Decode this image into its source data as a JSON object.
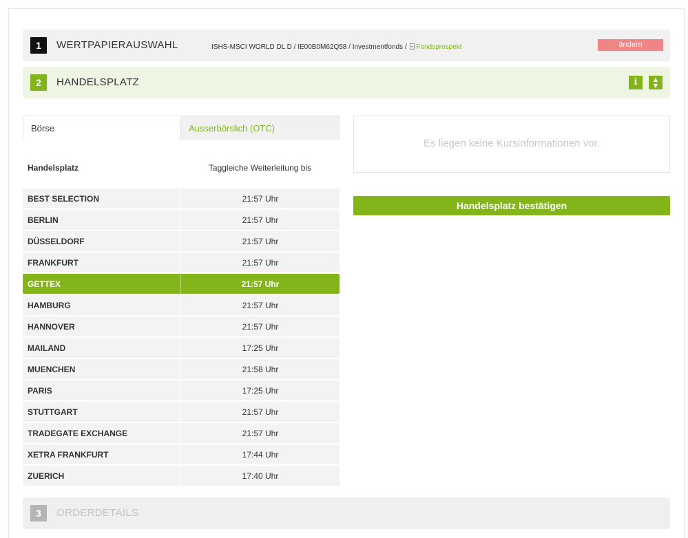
{
  "step1": {
    "number": "1",
    "title": "WERTPAPIERAUSWAHL",
    "security_info": "ISHS-MSCI WORLD DL D / IE00B0M62Q58 / Investmentfonds /",
    "prospekt_label": "Fondsprospekt",
    "change_label": "ändern",
    "change_color": "#f08585"
  },
  "step2": {
    "number": "2",
    "title": "HANDELSPLATZ",
    "info_icon": "i",
    "toggle_icon_up": "▲",
    "toggle_icon_down": "▼",
    "accent_color": "#83b51a"
  },
  "tabs": {
    "exchange": "Börse",
    "otc": "Ausserbörslich (OTC)",
    "active": "exchange"
  },
  "table": {
    "col_venue": "Handelsplatz",
    "col_time": "Taggleiche Weiterleitung bis",
    "rows": [
      {
        "venue": "BEST SELECTION",
        "time": "21:57 Uhr"
      },
      {
        "venue": "BERLIN",
        "time": "21:57 Uhr"
      },
      {
        "venue": "DÜSSELDORF",
        "time": "21:57 Uhr"
      },
      {
        "venue": "FRANKFURT",
        "time": "21:57 Uhr"
      },
      {
        "venue": "GETTEX",
        "time": "21:57 Uhr"
      },
      {
        "venue": "HAMBURG",
        "time": "21:57 Uhr"
      },
      {
        "venue": "HANNOVER",
        "time": "21:57 Uhr"
      },
      {
        "venue": "MAILAND",
        "time": "17:25 Uhr"
      },
      {
        "venue": "MUENCHEN",
        "time": "21:58 Uhr"
      },
      {
        "venue": "PARIS",
        "time": "17:25 Uhr"
      },
      {
        "venue": "STUTTGART",
        "time": "21:57 Uhr"
      },
      {
        "venue": "TRADEGATE EXCHANGE",
        "time": "21:57 Uhr"
      },
      {
        "venue": "XETRA FRANKFURT",
        "time": "17:44 Uhr"
      },
      {
        "venue": "ZUERICH",
        "time": "17:40 Uhr"
      }
    ],
    "selected": "GETTEX"
  },
  "quote": {
    "message": "Es liegen keine Kursinformationen vor."
  },
  "confirm_label": "Handelsplatz bestätigen",
  "step3": {
    "number": "3",
    "title": "ORDERDETAILS"
  }
}
